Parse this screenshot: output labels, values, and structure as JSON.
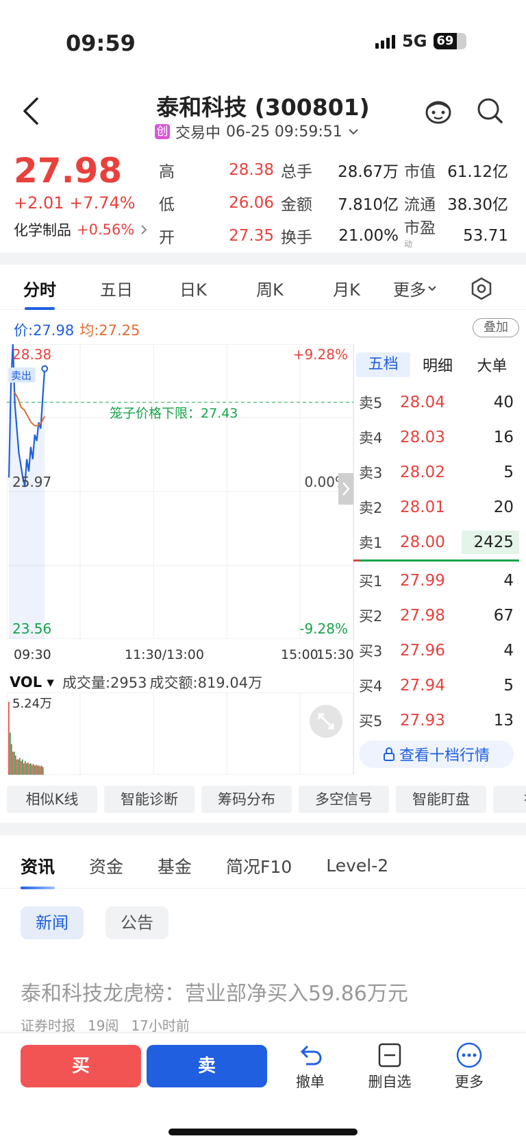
{
  "status": {
    "time": "09:59",
    "network": "5G",
    "battery": "69"
  },
  "header": {
    "title": "泰和科技 (300801)",
    "board_badge": "创",
    "status_text": "交易中",
    "datetime": "06-25 09:59:51"
  },
  "quote": {
    "price": "27.98",
    "change": "+2.01",
    "change_pct": "+7.74%",
    "sector_name": "化学制品",
    "sector_pct": "+0.56%",
    "rows": [
      {
        "l1": "高",
        "v1": "28.38",
        "l2": "总手",
        "v2": "28.67万",
        "l3": "市值",
        "v3": "61.12亿"
      },
      {
        "l1": "低",
        "v1": "26.06",
        "l2": "金额",
        "v2": "7.810亿",
        "l3": "流通",
        "v3": "38.30亿"
      },
      {
        "l1": "开",
        "v1": "27.35",
        "l2": "换手",
        "v2": "21.00%",
        "l3": "市盈",
        "v3": "53.71"
      }
    ],
    "pe_superscript": "动"
  },
  "chart_tabs": [
    "分时",
    "五日",
    "日K",
    "周K",
    "月K",
    "更多"
  ],
  "chart": {
    "legend_price_label": "价:27.98",
    "legend_avg_label": "均:27.25",
    "overlay_button": "叠加",
    "y_top": "28.38",
    "y_mid": "25.97",
    "y_bottom": "23.56",
    "pct_top": "+9.28%",
    "pct_mid": "0.00%",
    "pct_bottom": "-9.28%",
    "limit_line_label": "笼子价格下限：27.43",
    "sell_tag": "卖出",
    "time_labels": [
      "09:30",
      "11:30/13:00",
      "15:00",
      "15:30"
    ],
    "colors": {
      "price": "#1f5fe0",
      "avg": "#e36a2d",
      "up": "#e8413c",
      "down": "#16a34a"
    }
  },
  "chart_data": {
    "type": "line",
    "ylim": [
      23.56,
      28.38
    ],
    "series": [
      {
        "values": [
          26.2,
          27.7,
          28.38,
          27.4,
          27.0,
          26.6,
          26.4,
          26.2,
          26.06,
          26.5,
          26.3,
          26.7,
          26.5,
          26.9,
          26.8,
          27.1,
          27.0,
          27.5,
          27.98
        ]
      },
      {
        "values": [
          27.6,
          27.5,
          27.35,
          27.3,
          27.2,
          27.1,
          27.05,
          27.05,
          27.1,
          27.2
        ]
      }
    ],
    "volume_max": "5.24万",
    "volume": [
      0.95,
      0.55,
      0.4,
      0.3,
      0.3,
      0.25,
      0.2,
      0.2,
      0.22,
      0.18,
      0.2,
      0.15,
      0.18,
      0.15,
      0.16,
      0.14,
      0.15,
      0.13,
      0.14,
      0.12,
      0.13,
      0.12,
      0.12,
      0.11,
      0.12,
      0.1
    ]
  },
  "volume": {
    "selector": "VOL",
    "amount_text": "成交量:2953",
    "turnover_text": "成交额:819.04万",
    "max_label": "5.24万"
  },
  "order_book": {
    "tabs": [
      "五档",
      "明细",
      "大单"
    ],
    "asks": [
      {
        "label": "卖5",
        "price": "28.04",
        "vol": "40"
      },
      {
        "label": "卖4",
        "price": "28.03",
        "vol": "16"
      },
      {
        "label": "卖3",
        "price": "28.02",
        "vol": "5"
      },
      {
        "label": "卖2",
        "price": "28.01",
        "vol": "20"
      },
      {
        "label": "卖1",
        "price": "28.00",
        "vol": "2425"
      }
    ],
    "bids": [
      {
        "label": "买1",
        "price": "27.99",
        "vol": "4"
      },
      {
        "label": "买2",
        "price": "27.98",
        "vol": "67"
      },
      {
        "label": "买3",
        "price": "27.96",
        "vol": "4"
      },
      {
        "label": "买4",
        "price": "27.94",
        "vol": "5"
      },
      {
        "label": "买5",
        "price": "27.93",
        "vol": "13"
      }
    ],
    "more_label": "查看十档行情"
  },
  "tools": [
    "相似K线",
    "智能诊断",
    "筹码分布",
    "多空信号",
    "智能盯盘",
    "神奇"
  ],
  "news": {
    "tabs": [
      "资讯",
      "资金",
      "基金",
      "简况F10",
      "Level-2"
    ],
    "chips": [
      "新闻",
      "公告"
    ],
    "headline": "泰和科技龙虎榜：营业部净买入59.86万元",
    "source": "证券时报",
    "reads": "19阅",
    "time_ago": "17小时前"
  },
  "bottom": {
    "buy": "买",
    "sell": "卖",
    "actions": [
      "撤单",
      "删自选",
      "更多"
    ],
    "buy_color": "#f25353",
    "sell_color": "#1f5fe0"
  }
}
